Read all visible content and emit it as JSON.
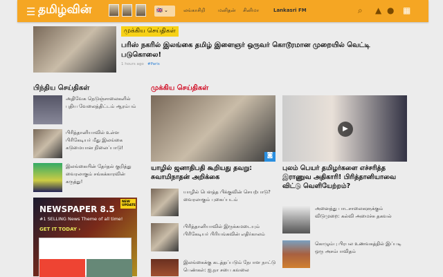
{
  "header": {
    "logo": "தமிழ்வின்",
    "lang": "🇬🇧 ⌄",
    "nav": [
      "லங்காசிறி",
      "மனிதன்",
      "சினிமா",
      "Lankasri FM"
    ]
  },
  "top_story": {
    "badge": "முக்கிய செய்திகள்",
    "title": "பரிஸ் நகரில் இலங்கை தமிழ் இளைஞர் ஒருவர் கொடூரமான முறையில் வெட்டி படுகொலை!",
    "time": "1 hours ago",
    "tag": "#Paris"
  },
  "latest": {
    "heading": "பிந்திய செய்திகள்",
    "items": [
      "அதிவேக நெடுஞ்சாலைகளில் புதிய வேலைத்திட்டம் ஆரம்பம்",
      "பிரித்தானியாவில் உள்ள பிரிகேடியர் மீது இலங்கை கடுமையான நிலைப்பாடு!",
      "இலங்கையின் தேர்தல் குறித்து வைரலாகும் சங்கக்காரவின் கருத்து!"
    ]
  },
  "ad": {
    "title": "NEWSPAPER 8.5",
    "subtitle": "#1 SELLING News Theme of all time!",
    "cta": "GET IT TODAY ›",
    "badge": "NEW UPDATE"
  },
  "main": {
    "heading": "முக்கிய செய்திகள்",
    "lead": "யாழில் ஜனாதிபதி கூறியது தவறு: சுவாமிநாதன் அறிக்கை",
    "items": [
      "யாழில் பௌத்த பிக்குவின் செயற்பாடு? வைரலாகும் புகைப்படம்",
      "பிரித்தானியாவில் இருக்கமடையும் பிரிகேடியர் பிரியங்கவின் எதிர்காலம்",
      "இலங்கைக்கு கடத்தப்படும் நேபாள நாட்டு பெண்கள்: ஐ.நா சபை கவலை"
    ]
  },
  "right": {
    "lead": "புலம் பெயர் தமிழர்களை எச்சரித்த இராணுவ அதிகாரி! பிரித்தானியாவை விட்டு வெளியேற்றம்?",
    "items": [
      "அனைத்து பாடசாலைகளுக்கும் விடுமுறை: கல்வி அமைச்சு தகவல்",
      "கொழும்பு பிரபல உணவகத்தில் இப்படி ஒரு அசம்பாவிதம்"
    ]
  }
}
